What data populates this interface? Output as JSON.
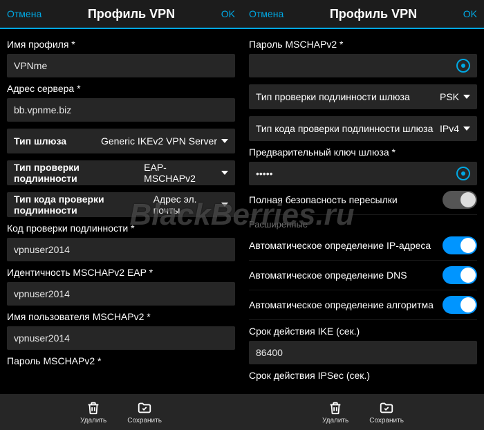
{
  "watermark": "BlackBerries.ru",
  "header": {
    "cancel": "Отмена",
    "title": "Профиль VPN",
    "ok": "OK"
  },
  "footer": {
    "delete": "Удалить",
    "save": "Сохранить"
  },
  "left": {
    "profile_name_label": "Имя профиля *",
    "profile_name_value": "VPNme",
    "server_address_label": "Адрес сервера *",
    "server_address_value": "bb.vpnme.biz",
    "gateway_type_label": "Тип шлюза",
    "gateway_type_value": "Generic IKEv2 VPN Server",
    "auth_type_label": "Тип проверки подлинности",
    "auth_type_value": "EAP-MSCHAPv2",
    "auth_code_type_label": "Тип кода проверки подлинности",
    "auth_code_type_value": "Адрес эл. почты",
    "auth_code_label": "Код проверки подлинности *",
    "auth_code_value": "vpnuser2014",
    "identity_label": "Идентичность MSCHAPv2 EAP *",
    "identity_value": "vpnuser2014",
    "username_label": "Имя пользователя MSCHAPv2 *",
    "username_value": "vpnuser2014",
    "password_label": "Пароль MSCHAPv2 *"
  },
  "right": {
    "password_label": "Пароль MSCHAPv2 *",
    "password_value": "",
    "gateway_auth_type_label": "Тип проверки подлинности шлюза",
    "gateway_auth_type_value": "PSK",
    "gateway_code_type_label": "Тип кода проверки подлинности шлюза",
    "gateway_code_type_value": "IPv4",
    "psk_label": "Предварительный ключ шлюза *",
    "psk_value": "•••••",
    "pfs_label": "Полная безопасность пересылки",
    "pfs_on": false,
    "advanced_header": "Расширенные",
    "auto_ip_label": "Автоматическое определение IP-адреса",
    "auto_ip_on": true,
    "auto_dns_label": "Автоматическое определение DNS",
    "auto_dns_on": true,
    "auto_algo_label": "Автоматическое определение алгоритма",
    "auto_algo_on": true,
    "ike_lifetime_label": "Срок действия IKE (сек.)",
    "ike_lifetime_value": "86400",
    "ipsec_lifetime_label": "Срок действия IPSec (сек.)"
  }
}
